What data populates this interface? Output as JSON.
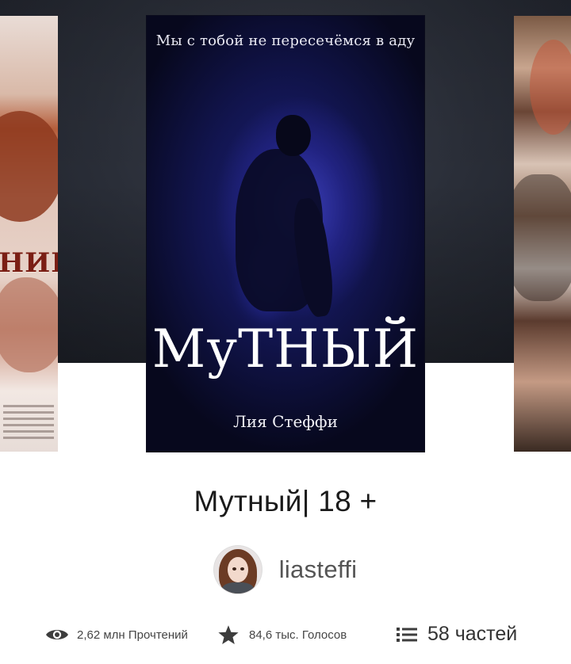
{
  "carousel": {
    "left_cover": {
      "title_fragment": "НИЕ"
    },
    "main_cover": {
      "tagline": "Мы с тобой не пересечёмся в аду",
      "title": "МуТНЫЙ",
      "author": "Лия Стеффи"
    }
  },
  "story": {
    "title": "Мутный| 18 +",
    "author": "liasteffi"
  },
  "stats": {
    "reads": "2,62 млн Прочтений",
    "votes": "84,6 тыс. Голосов",
    "parts": "58 частей"
  },
  "icons": {
    "reads": "eye-icon",
    "votes": "star-icon",
    "parts": "list-icon"
  }
}
